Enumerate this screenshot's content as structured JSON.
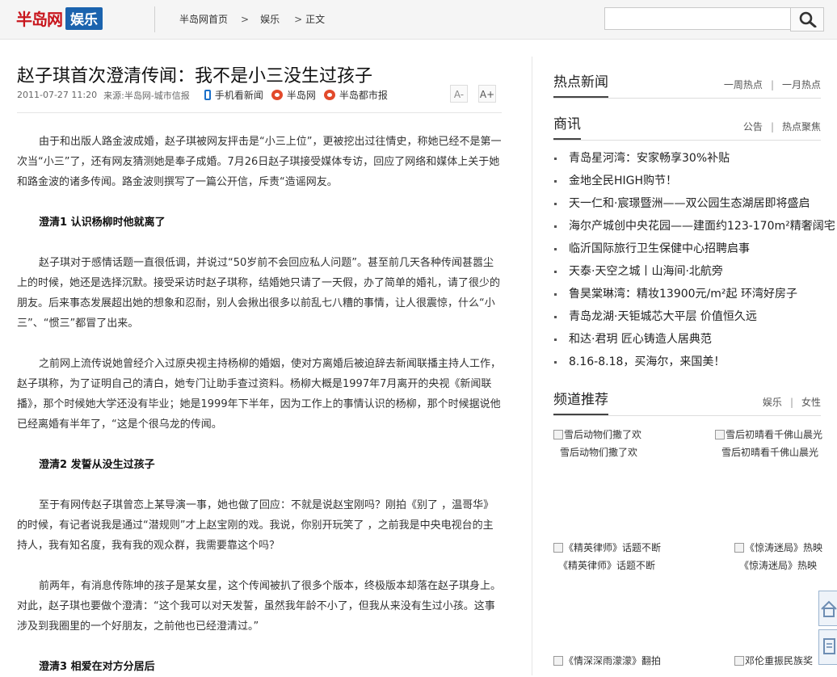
{
  "header": {
    "logo_text": "半岛网",
    "logo_badge": "娱乐",
    "breadcrumb": [
      "半岛网首页",
      "娱乐",
      "正文"
    ],
    "search": {
      "placeholder": ""
    }
  },
  "article": {
    "title": "赵子琪首次澄清传闻：我不是小三没生过孩子",
    "date": "2011-07-27 11:20",
    "source": "来源:半岛网-城市信报",
    "links": [
      "手机看新闻",
      "半岛网",
      "半岛都市报"
    ],
    "font_smaller": "A-",
    "font_larger": "A+",
    "paragraphs": [
      {
        "type": "p",
        "text": "由于和出版人路金波成婚，赵子琪被网友抨击是“小三上位”，更被挖出过往情史，称她已经不是第一次当“小三”了，还有网友猜测她是奉子成婚。7月26日赵子琪接受媒体专访，回应了网络和媒体上关于她和路金波的诸多传闻。路金波则撰写了一篇公开信，斥责“造谣网友。"
      },
      {
        "type": "h",
        "text": "澄清1 认识杨柳时他就离了"
      },
      {
        "type": "p",
        "text": "赵子琪对于感情话题一直很低调，并说过“50岁前不会回应私人问题”。甚至前几天各种传闻甚嚣尘上的时候，她还是选择沉默。接受采访时赵子琪称，结婚她只请了一天假，办了简单的婚礼，请了很少的朋友。后来事态发展超出她的想象和忍耐，别人会揪出很多以前乱七八糟的事情，让人很震惊，什么“小三”、“惯三”都冒了出来。"
      },
      {
        "type": "p",
        "text": "之前网上流传说她曾经介入过原央视主持杨柳的婚姻，使对方离婚后被迫辞去新闻联播主持人工作，赵子琪称，为了证明自己的清白，她专门让助手查过资料。杨柳大概是1997年7月离开的央视《新闻联播》，那个时候她大学还没有毕业；她是1999年下半年，因为工作上的事情认识的杨柳，那个时候据说他已经离婚有半年了，“这是个很乌龙的传闻。"
      },
      {
        "type": "h",
        "text": "澄清2 发誓从没生过孩子"
      },
      {
        "type": "p",
        "text": "至于有网传赵子琪曾恋上某导演一事，她也做了回应：不就是说赵宝刚吗？刚拍《别了 ，温哥华》的时候，有记者说我是通过“潜规则”才上赵宝刚的戏。我说，你别开玩笑了 ，之前我是中央电视台的主持人，我有知名度，我有我的观众群，我需要靠这个吗？"
      },
      {
        "type": "p",
        "text": "前两年，有消息传陈坤的孩子是某女星，这个传闻被扒了很多个版本，终极版本却落在赵子琪身上。对此，赵子琪也要做个澄清：“这个我可以对天发誓，虽然我年龄不小了，但我从来没有生过小孩。这事涉及到我圈里的一个好朋友，之前他也已经澄清过。”"
      },
      {
        "type": "h",
        "text": "澄清3 相爱在对方分居后"
      }
    ]
  },
  "sidebar": {
    "hot": {
      "title": "热点新闻",
      "links": [
        "一周热点",
        "一月热点"
      ]
    },
    "business": {
      "title": "商讯",
      "links": [
        "公告",
        "热点聚焦"
      ],
      "items": [
        "青岛星河湾：安家畅享30%补贴",
        "金地全民HIGH购节！",
        "天一仁和·宸璟暨洲——双公园生态湖居即将盛启",
        "海尔产城创中央花园——建面约123-170m²精奢阔宅",
        "临沂国际旅行卫生保健中心招聘启事",
        "天泰·天空之城丨山海间·北航旁",
        "鲁昊棠琳湾：精妆13900元/m²起 环湾好房子",
        "青岛龙湖·天钜城芯大平层 价值恒久远",
        "和达·君玥 匠心铸造人居典范",
        "8.16-8.18，买海尔，来国美！"
      ]
    },
    "channel": {
      "title": "频道推荐",
      "links": [
        "娱乐",
        "女性"
      ],
      "cards": [
        {
          "alt": "雪后动物们撒了欢",
          "caption": "雪后动物们撒了欢"
        },
        {
          "alt": "雪后初晴看千佛山晨光",
          "caption": "雪后初晴看千佛山晨光"
        },
        {
          "alt": "《精英律师》话题不断",
          "caption": "《精英律师》话题不断"
        },
        {
          "alt": "《惊涛迷局》热映",
          "caption": "《惊涛迷局》热映"
        },
        {
          "alt": "《情深深雨濛濛》翻拍",
          "caption": ""
        },
        {
          "alt": "邓伦重振民族奖",
          "caption": ""
        }
      ]
    }
  }
}
